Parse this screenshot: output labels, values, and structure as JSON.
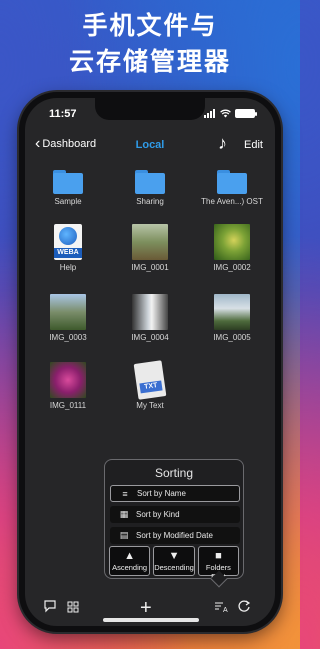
{
  "headline": {
    "line1": "手机文件与",
    "line2": "云存储管理器"
  },
  "status": {
    "time": "11:57",
    "icons": [
      "signal-icon",
      "wifi-icon",
      "battery-icon"
    ]
  },
  "nav": {
    "back_label": "Dashboard",
    "title": "Local",
    "edit_label": "Edit",
    "music_icon": "music-note-icon"
  },
  "files": [
    {
      "name": "Sample",
      "kind": "folder"
    },
    {
      "name": "Sharing",
      "kind": "folder"
    },
    {
      "name": "The Aven...) OST",
      "kind": "folder"
    },
    {
      "name": "Help",
      "kind": "webarchive",
      "badge": "WEBA"
    },
    {
      "name": "IMG_0001",
      "kind": "image"
    },
    {
      "name": "IMG_0002",
      "kind": "image"
    },
    {
      "name": "IMG_0003",
      "kind": "image"
    },
    {
      "name": "IMG_0004",
      "kind": "image"
    },
    {
      "name": "IMG_0005",
      "kind": "image"
    },
    {
      "name": "IMG_0111",
      "kind": "image"
    },
    {
      "name": "My Text",
      "kind": "text",
      "badge": "TXT"
    }
  ],
  "sorting": {
    "title": "Sorting",
    "options": [
      {
        "label": "Sort by Name",
        "selected": true
      },
      {
        "label": "Sort by Kind",
        "selected": false
      },
      {
        "label": "Sort by Modified Date",
        "selected": false
      }
    ],
    "directions": [
      {
        "label": "Ascending",
        "icon": "triangle-up-icon"
      },
      {
        "label": "Descending",
        "icon": "triangle-down-icon"
      },
      {
        "label": "Folders First",
        "icon": "folder-icon"
      }
    ]
  },
  "toolbar": {
    "icons": [
      "comment-icon",
      "grid-view-icon",
      "add-icon",
      "sort-icon",
      "refresh-icon"
    ]
  },
  "colors": {
    "accent": "#2f9be8",
    "folder": "#4aa0ee",
    "screen_bg": "#262628"
  }
}
